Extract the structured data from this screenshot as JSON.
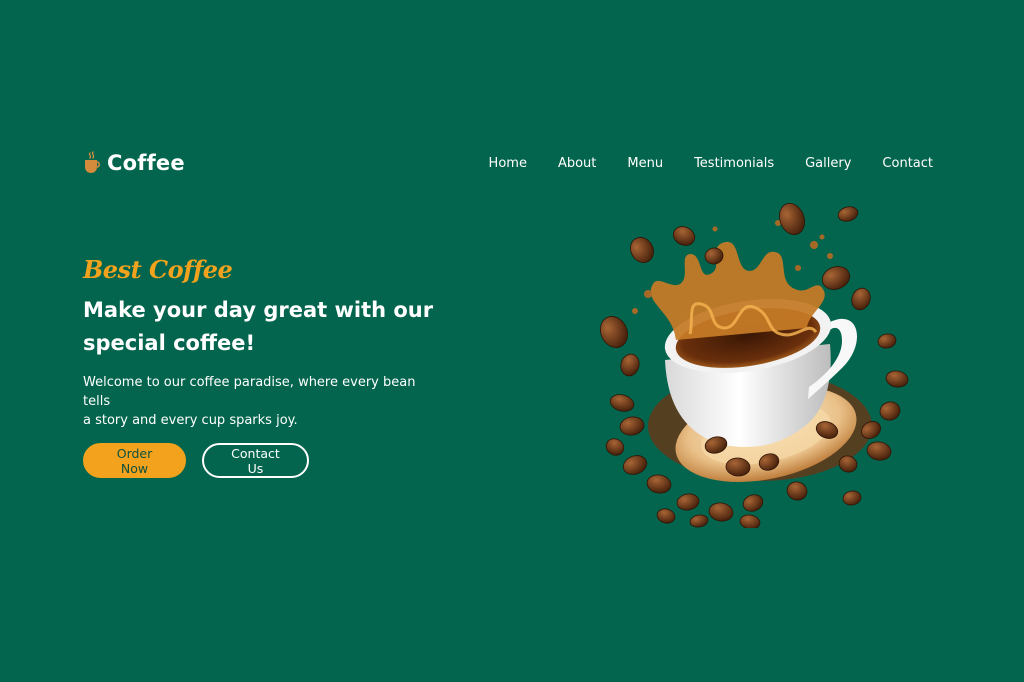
{
  "brand": {
    "icon": "coffee-cup-icon",
    "name": "Coffee"
  },
  "nav": {
    "items": [
      {
        "label": "Home"
      },
      {
        "label": "About"
      },
      {
        "label": "Menu"
      },
      {
        "label": "Testimonials"
      },
      {
        "label": "Gallery"
      },
      {
        "label": "Contact"
      }
    ]
  },
  "hero": {
    "eyebrow": "Best Coffee",
    "headline_line1": "Make your day great with our",
    "headline_line2": "special coffee!",
    "description_line1": "Welcome to our coffee paradise, where every bean tells",
    "description_line2": "a story and every cup sparks joy.",
    "primary_button": "Order Now",
    "secondary_button": "Contact Us"
  },
  "colors": {
    "background": "#03654d",
    "accent": "#f2a21c",
    "text": "#ffffff"
  }
}
